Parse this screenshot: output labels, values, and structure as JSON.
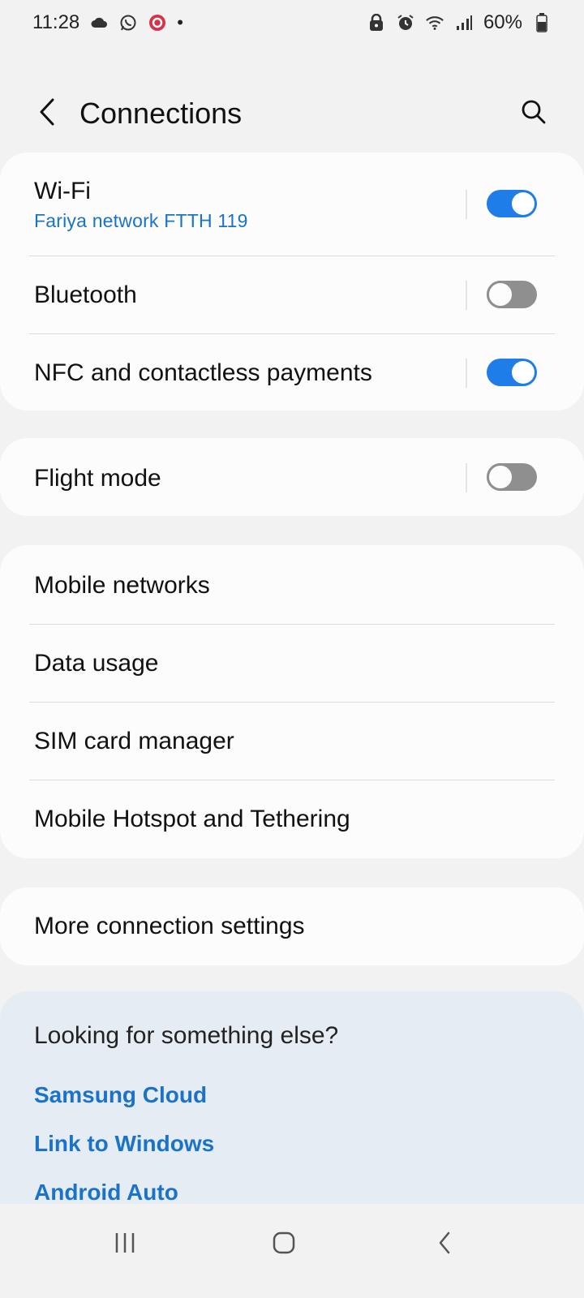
{
  "status_bar": {
    "time": "11:28",
    "left_icons": [
      "cloud-icon",
      "whatsapp-icon",
      "recorder-icon",
      "dot-icon"
    ],
    "right_icons": [
      "lock-icon",
      "alarm-icon",
      "wifi-icon",
      "signal-icon",
      "battery-icon"
    ],
    "battery": "60%"
  },
  "header": {
    "title": "Connections",
    "back_icon": "chevron-left-icon",
    "search_icon": "search-icon"
  },
  "groups": {
    "wireless": [
      {
        "label": "Wi-Fi",
        "sublabel": "Fariya network FTTH  119",
        "toggle": "on"
      },
      {
        "label": "Bluetooth",
        "toggle": "off"
      },
      {
        "label": "NFC and contactless payments",
        "toggle": "on"
      }
    ],
    "flight": [
      {
        "label": "Flight mode",
        "toggle": "off"
      }
    ],
    "mobile": [
      {
        "label": "Mobile networks"
      },
      {
        "label": "Data usage"
      },
      {
        "label": "SIM card manager"
      },
      {
        "label": "Mobile Hotspot and Tethering"
      }
    ],
    "more": [
      {
        "label": "More connection settings"
      }
    ]
  },
  "suggestions": {
    "title": "Looking for something else?",
    "links": [
      "Samsung Cloud",
      "Link to Windows",
      "Android Auto"
    ]
  },
  "nav_bar": {
    "icons": [
      "recent-apps-icon",
      "home-icon",
      "back-icon"
    ]
  },
  "colors": {
    "accent": "#1e7de8",
    "link": "#1a73c8",
    "toggle_off": "#8f8f8f",
    "background": "#f2f2f2",
    "card": "#fcfcfc",
    "suggest_card": "#e6ecf3"
  }
}
